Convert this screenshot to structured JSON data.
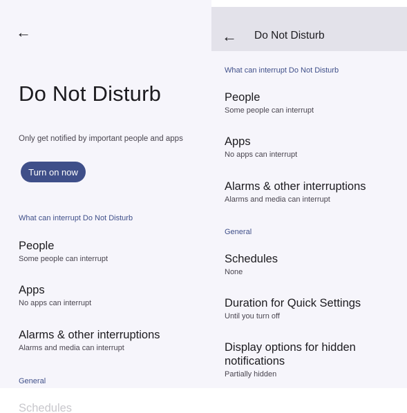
{
  "left": {
    "back_icon": "←",
    "title": "Do Not Disturb",
    "description": "Only get notified by important people and apps",
    "turn_on_label": "Turn on now",
    "section_interrupt": "What can interrupt Do Not Disturb",
    "items": [
      {
        "title": "People",
        "subtitle": "Some people can interrupt"
      },
      {
        "title": "Apps",
        "subtitle": "No apps can interrupt"
      },
      {
        "title": "Alarms & other interruptions",
        "subtitle": "Alarms and media can interrupt"
      }
    ],
    "section_general": "General",
    "faded_item": "Schedules"
  },
  "right": {
    "back_icon": "←",
    "title": "Do Not Disturb",
    "section_interrupt": "What can interrupt Do Not Disturb",
    "items": [
      {
        "title": "People",
        "subtitle": "Some people can interrupt"
      },
      {
        "title": "Apps",
        "subtitle": "No apps can interrupt"
      },
      {
        "title": "Alarms & other interruptions",
        "subtitle": "Alarms and media can interrupt"
      }
    ],
    "section_general": "General",
    "general_items": [
      {
        "title": "Schedules",
        "subtitle": "None"
      },
      {
        "title": "Duration for Quick Settings",
        "subtitle": "Until you turn off"
      },
      {
        "title": "Display options for hidden notifications",
        "subtitle": "Partially hidden"
      }
    ]
  },
  "colors": {
    "background": "#f6f5fb",
    "accent": "#3f4f89",
    "app_bar": "#e3e2ea"
  }
}
